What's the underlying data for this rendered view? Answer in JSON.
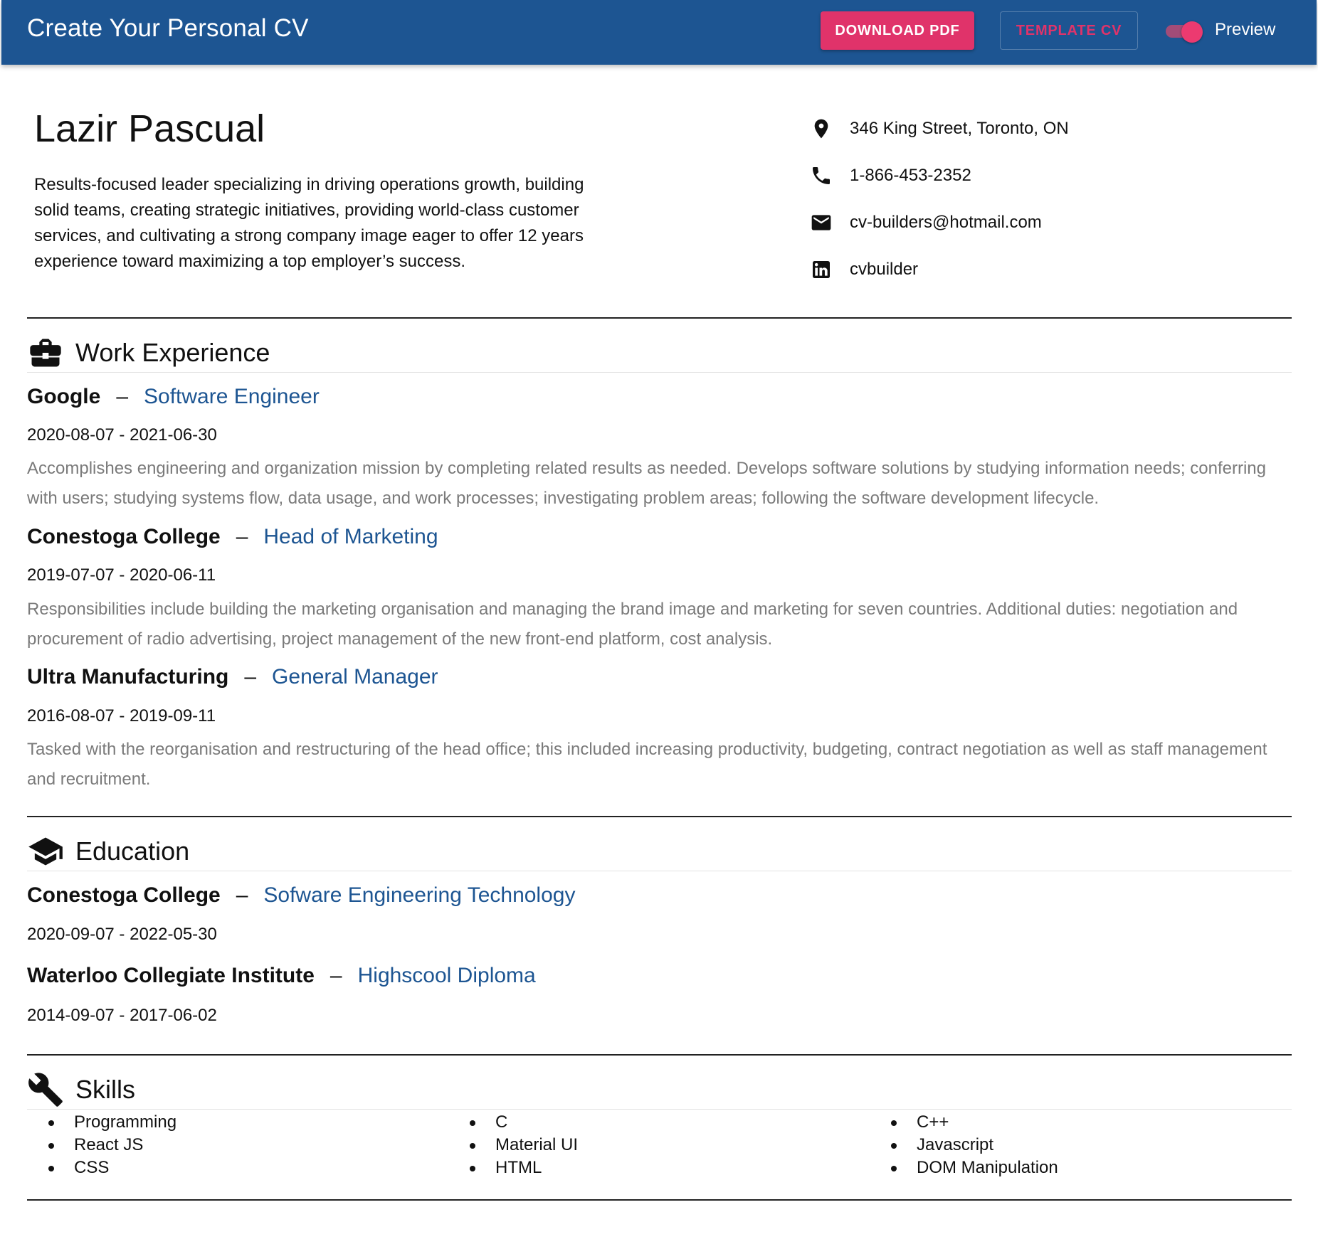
{
  "appbar": {
    "title": "Create Your Personal CV",
    "download_label": "DOWNLOAD PDF",
    "template_label": "TEMPLATE CV",
    "preview_label": "Preview",
    "preview_on": true
  },
  "profile": {
    "name": "Lazir Pascual",
    "summary": "Results-focused leader specializing in driving operations growth, building solid teams, creating strategic initiatives, providing world-class customer services, and cultivating a strong company image eager to offer 12 years experience toward maximizing a top employer’s success.",
    "address": "346 King Street, Toronto, ON",
    "phone": "1-866-453-2352",
    "email": "cv-builders@hotmail.com",
    "linkedin": "cvbuilder"
  },
  "work": {
    "title": "Work Experience",
    "entries": [
      {
        "org": "Google",
        "role": "Software Engineer",
        "dates": "2020-08-07 - 2021-06-30",
        "desc": "Accomplishes engineering and organization mission by completing related results as needed. Develops software solutions by studying information needs; conferring with users; studying systems flow, data usage, and work processes; investigating problem areas; following the software development lifecycle."
      },
      {
        "org": "Conestoga College",
        "role": "Head of Marketing",
        "dates": "2019-07-07 - 2020-06-11",
        "desc": "Responsibilities include building the marketing organisation and managing the brand image and marketing for seven countries. Additional duties: negotiation and procurement of radio advertising, project management of the new front-end platform, cost analysis."
      },
      {
        "org": "Ultra Manufacturing",
        "role": "General Manager",
        "dates": "2016-08-07 - 2019-09-11",
        "desc": "Tasked with the reorganisation and restructuring of the head office; this included increasing productivity, budgeting, contract negotiation as well as staff management and recruitment."
      }
    ]
  },
  "education": {
    "title": "Education",
    "entries": [
      {
        "org": "Conestoga College",
        "role": "Sofware Engineering Technology",
        "dates": "2020-09-07 - 2022-05-30"
      },
      {
        "org": "Waterloo Collegiate Institute",
        "role": "Highscool Diploma",
        "dates": "2014-09-07 - 2017-06-02"
      }
    ]
  },
  "skills": {
    "title": "Skills",
    "columns": [
      [
        "Programming",
        "React JS",
        "CSS"
      ],
      [
        "C",
        "Material UI",
        "HTML"
      ],
      [
        "C++",
        "Javascript",
        "DOM Manipulation"
      ]
    ]
  },
  "colors": {
    "appbar": "#1d5592",
    "accent": "#e0336a",
    "role_text": "#1d5592",
    "desc_text": "#7a7a7a"
  }
}
